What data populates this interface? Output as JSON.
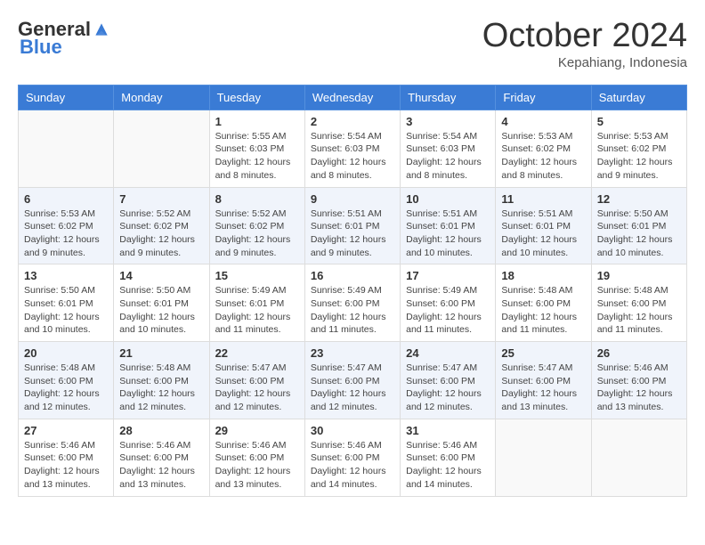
{
  "header": {
    "logo": {
      "general": "General",
      "blue": "Blue"
    },
    "title": "October 2024",
    "location": "Kepahiang, Indonesia"
  },
  "calendar": {
    "days_of_week": [
      "Sunday",
      "Monday",
      "Tuesday",
      "Wednesday",
      "Thursday",
      "Friday",
      "Saturday"
    ],
    "weeks": [
      [
        {
          "day": "",
          "sunrise": "",
          "sunset": "",
          "daylight": "",
          "empty": true
        },
        {
          "day": "",
          "sunrise": "",
          "sunset": "",
          "daylight": "",
          "empty": true
        },
        {
          "day": "1",
          "sunrise": "Sunrise: 5:55 AM",
          "sunset": "Sunset: 6:03 PM",
          "daylight": "Daylight: 12 hours and 8 minutes."
        },
        {
          "day": "2",
          "sunrise": "Sunrise: 5:54 AM",
          "sunset": "Sunset: 6:03 PM",
          "daylight": "Daylight: 12 hours and 8 minutes."
        },
        {
          "day": "3",
          "sunrise": "Sunrise: 5:54 AM",
          "sunset": "Sunset: 6:03 PM",
          "daylight": "Daylight: 12 hours and 8 minutes."
        },
        {
          "day": "4",
          "sunrise": "Sunrise: 5:53 AM",
          "sunset": "Sunset: 6:02 PM",
          "daylight": "Daylight: 12 hours and 8 minutes."
        },
        {
          "day": "5",
          "sunrise": "Sunrise: 5:53 AM",
          "sunset": "Sunset: 6:02 PM",
          "daylight": "Daylight: 12 hours and 9 minutes."
        }
      ],
      [
        {
          "day": "6",
          "sunrise": "Sunrise: 5:53 AM",
          "sunset": "Sunset: 6:02 PM",
          "daylight": "Daylight: 12 hours and 9 minutes."
        },
        {
          "day": "7",
          "sunrise": "Sunrise: 5:52 AM",
          "sunset": "Sunset: 6:02 PM",
          "daylight": "Daylight: 12 hours and 9 minutes."
        },
        {
          "day": "8",
          "sunrise": "Sunrise: 5:52 AM",
          "sunset": "Sunset: 6:02 PM",
          "daylight": "Daylight: 12 hours and 9 minutes."
        },
        {
          "day": "9",
          "sunrise": "Sunrise: 5:51 AM",
          "sunset": "Sunset: 6:01 PM",
          "daylight": "Daylight: 12 hours and 9 minutes."
        },
        {
          "day": "10",
          "sunrise": "Sunrise: 5:51 AM",
          "sunset": "Sunset: 6:01 PM",
          "daylight": "Daylight: 12 hours and 10 minutes."
        },
        {
          "day": "11",
          "sunrise": "Sunrise: 5:51 AM",
          "sunset": "Sunset: 6:01 PM",
          "daylight": "Daylight: 12 hours and 10 minutes."
        },
        {
          "day": "12",
          "sunrise": "Sunrise: 5:50 AM",
          "sunset": "Sunset: 6:01 PM",
          "daylight": "Daylight: 12 hours and 10 minutes."
        }
      ],
      [
        {
          "day": "13",
          "sunrise": "Sunrise: 5:50 AM",
          "sunset": "Sunset: 6:01 PM",
          "daylight": "Daylight: 12 hours and 10 minutes."
        },
        {
          "day": "14",
          "sunrise": "Sunrise: 5:50 AM",
          "sunset": "Sunset: 6:01 PM",
          "daylight": "Daylight: 12 hours and 10 minutes."
        },
        {
          "day": "15",
          "sunrise": "Sunrise: 5:49 AM",
          "sunset": "Sunset: 6:01 PM",
          "daylight": "Daylight: 12 hours and 11 minutes."
        },
        {
          "day": "16",
          "sunrise": "Sunrise: 5:49 AM",
          "sunset": "Sunset: 6:00 PM",
          "daylight": "Daylight: 12 hours and 11 minutes."
        },
        {
          "day": "17",
          "sunrise": "Sunrise: 5:49 AM",
          "sunset": "Sunset: 6:00 PM",
          "daylight": "Daylight: 12 hours and 11 minutes."
        },
        {
          "day": "18",
          "sunrise": "Sunrise: 5:48 AM",
          "sunset": "Sunset: 6:00 PM",
          "daylight": "Daylight: 12 hours and 11 minutes."
        },
        {
          "day": "19",
          "sunrise": "Sunrise: 5:48 AM",
          "sunset": "Sunset: 6:00 PM",
          "daylight": "Daylight: 12 hours and 11 minutes."
        }
      ],
      [
        {
          "day": "20",
          "sunrise": "Sunrise: 5:48 AM",
          "sunset": "Sunset: 6:00 PM",
          "daylight": "Daylight: 12 hours and 12 minutes."
        },
        {
          "day": "21",
          "sunrise": "Sunrise: 5:48 AM",
          "sunset": "Sunset: 6:00 PM",
          "daylight": "Daylight: 12 hours and 12 minutes."
        },
        {
          "day": "22",
          "sunrise": "Sunrise: 5:47 AM",
          "sunset": "Sunset: 6:00 PM",
          "daylight": "Daylight: 12 hours and 12 minutes."
        },
        {
          "day": "23",
          "sunrise": "Sunrise: 5:47 AM",
          "sunset": "Sunset: 6:00 PM",
          "daylight": "Daylight: 12 hours and 12 minutes."
        },
        {
          "day": "24",
          "sunrise": "Sunrise: 5:47 AM",
          "sunset": "Sunset: 6:00 PM",
          "daylight": "Daylight: 12 hours and 12 minutes."
        },
        {
          "day": "25",
          "sunrise": "Sunrise: 5:47 AM",
          "sunset": "Sunset: 6:00 PM",
          "daylight": "Daylight: 12 hours and 13 minutes."
        },
        {
          "day": "26",
          "sunrise": "Sunrise: 5:46 AM",
          "sunset": "Sunset: 6:00 PM",
          "daylight": "Daylight: 12 hours and 13 minutes."
        }
      ],
      [
        {
          "day": "27",
          "sunrise": "Sunrise: 5:46 AM",
          "sunset": "Sunset: 6:00 PM",
          "daylight": "Daylight: 12 hours and 13 minutes."
        },
        {
          "day": "28",
          "sunrise": "Sunrise: 5:46 AM",
          "sunset": "Sunset: 6:00 PM",
          "daylight": "Daylight: 12 hours and 13 minutes."
        },
        {
          "day": "29",
          "sunrise": "Sunrise: 5:46 AM",
          "sunset": "Sunset: 6:00 PM",
          "daylight": "Daylight: 12 hours and 13 minutes."
        },
        {
          "day": "30",
          "sunrise": "Sunrise: 5:46 AM",
          "sunset": "Sunset: 6:00 PM",
          "daylight": "Daylight: 12 hours and 14 minutes."
        },
        {
          "day": "31",
          "sunrise": "Sunrise: 5:46 AM",
          "sunset": "Sunset: 6:00 PM",
          "daylight": "Daylight: 12 hours and 14 minutes."
        },
        {
          "day": "",
          "sunrise": "",
          "sunset": "",
          "daylight": "",
          "empty": true
        },
        {
          "day": "",
          "sunrise": "",
          "sunset": "",
          "daylight": "",
          "empty": true
        }
      ]
    ]
  }
}
